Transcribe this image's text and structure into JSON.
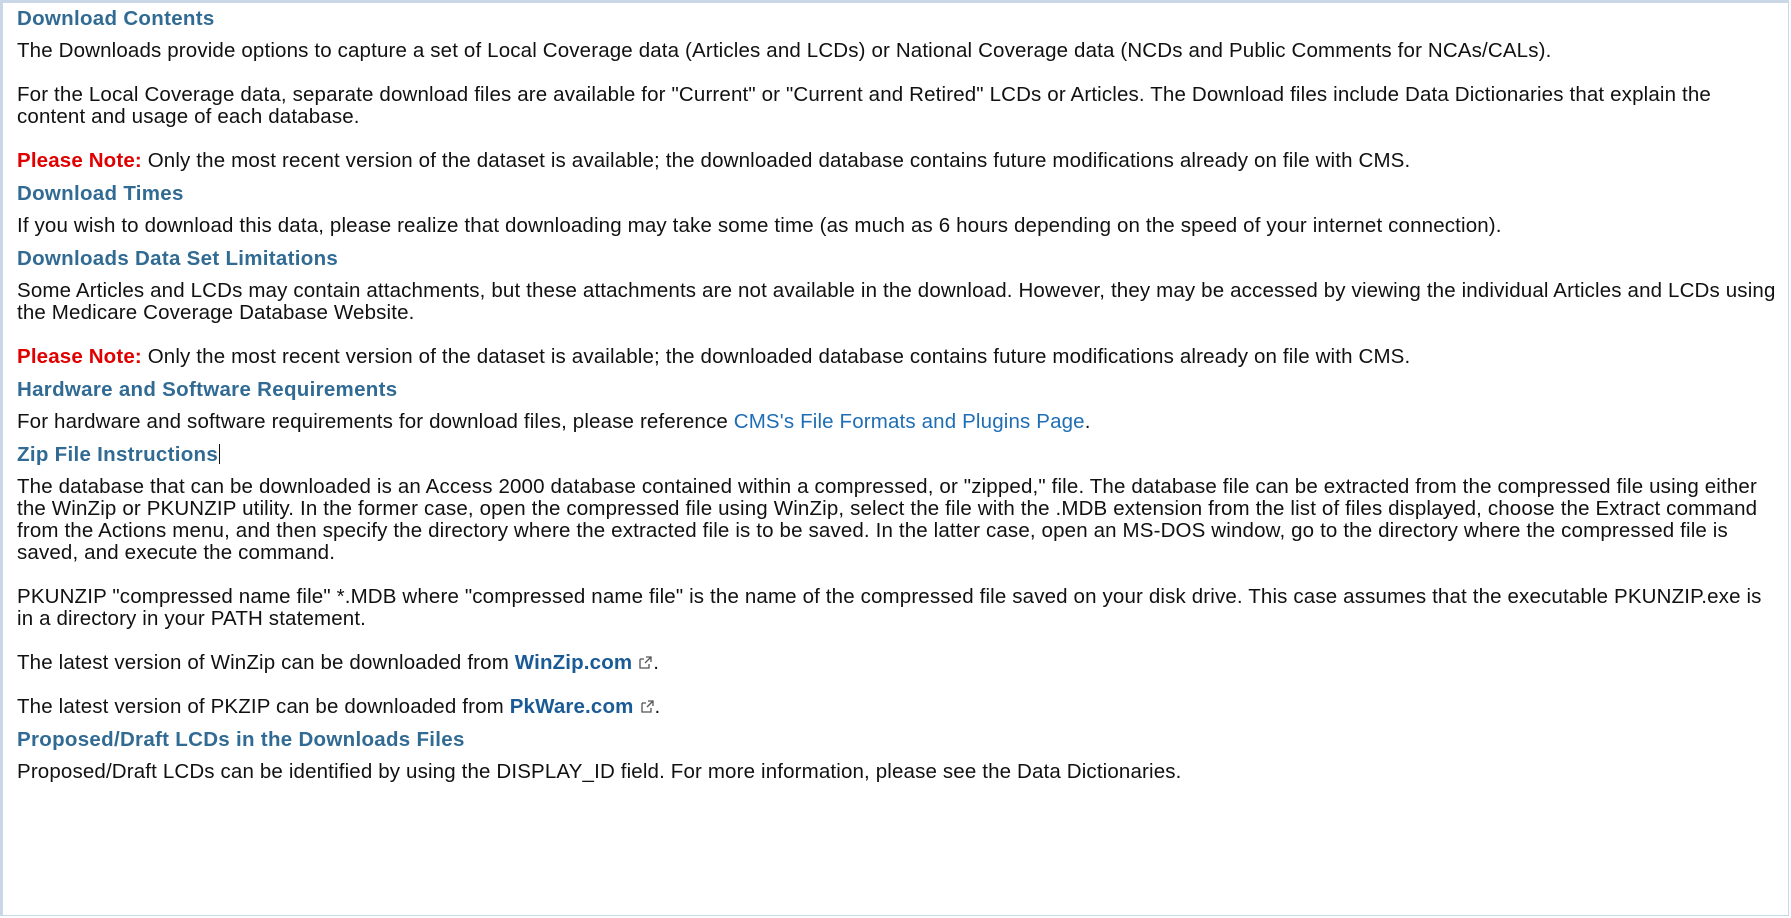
{
  "sections": {
    "download_contents": {
      "heading": "Download Contents",
      "p1": "The Downloads provide options to capture a set of Local Coverage data (Articles and LCDs) or National Coverage data (NCDs and Public Comments for NCAs/CALs).",
      "p2": "For the Local Coverage data, separate download files are available for \"Current\" or \"Current and Retired\" LCDs or Articles. The Download files include Data Dictionaries that explain the content and usage of each database.",
      "note_label": "Please Note:",
      "note_text": " Only the most recent version of the dataset is available; the downloaded database contains future modifications already on file with CMS."
    },
    "download_times": {
      "heading": "Download Times",
      "p1": "If you wish to download this data, please realize that downloading may take some time (as much as 6 hours depending on the speed of your internet connection)."
    },
    "limitations": {
      "heading": "Downloads Data Set Limitations",
      "p1": "Some Articles and LCDs may contain attachments, but these attachments are not available in the download. However, they may be accessed by viewing the individual Articles and LCDs using the Medicare Coverage Database Website.",
      "note_label": "Please Note:",
      "note_text": " Only the most recent version of the dataset is available; the downloaded database contains future modifications already on file with CMS."
    },
    "requirements": {
      "heading": "Hardware and Software Requirements",
      "text_before": "For hardware and software requirements for download files, please reference ",
      "link": "CMS's File Formats and Plugins Page",
      "text_after": "."
    },
    "zip": {
      "heading": "Zip File Instructions",
      "p1": "The database that can be downloaded is an Access 2000 database contained within a compressed, or \"zipped,\" file. The database file can be extracted from the compressed file using either the WinZip or PKUNZIP utility. In the former case, open the compressed file using WinZip, select the file with the .MDB extension from the list of files displayed, choose the Extract command from the Actions menu, and then specify the directory where the extracted file is to be saved. In the latter case, open an MS-DOS window, go to the directory where the compressed file is saved, and execute the command.",
      "p2": "PKUNZIP \"compressed name file\" *.MDB where \"compressed name file\" is the name of the compressed file saved on your disk drive. This case assumes that the executable PKUNZIP.exe is in a directory in your PATH statement.",
      "winzip_before": "The latest version of WinZip can be downloaded from ",
      "winzip_link": "WinZip.com",
      "winzip_after": ".",
      "pkzip_before": "The latest version of PKZIP can be downloaded from ",
      "pkzip_link": "PkWare.com",
      "pkzip_after": "."
    },
    "proposed": {
      "heading": "Proposed/Draft LCDs in the Downloads Files",
      "p1": "Proposed/Draft LCDs can be identified by using the DISPLAY_ID field. For more information, please see the Data Dictionaries."
    }
  },
  "colors": {
    "heading": "#316b94",
    "note": "#e00000",
    "link": "#1f6eb5"
  },
  "icons": {
    "external_link": "external-link-icon"
  }
}
